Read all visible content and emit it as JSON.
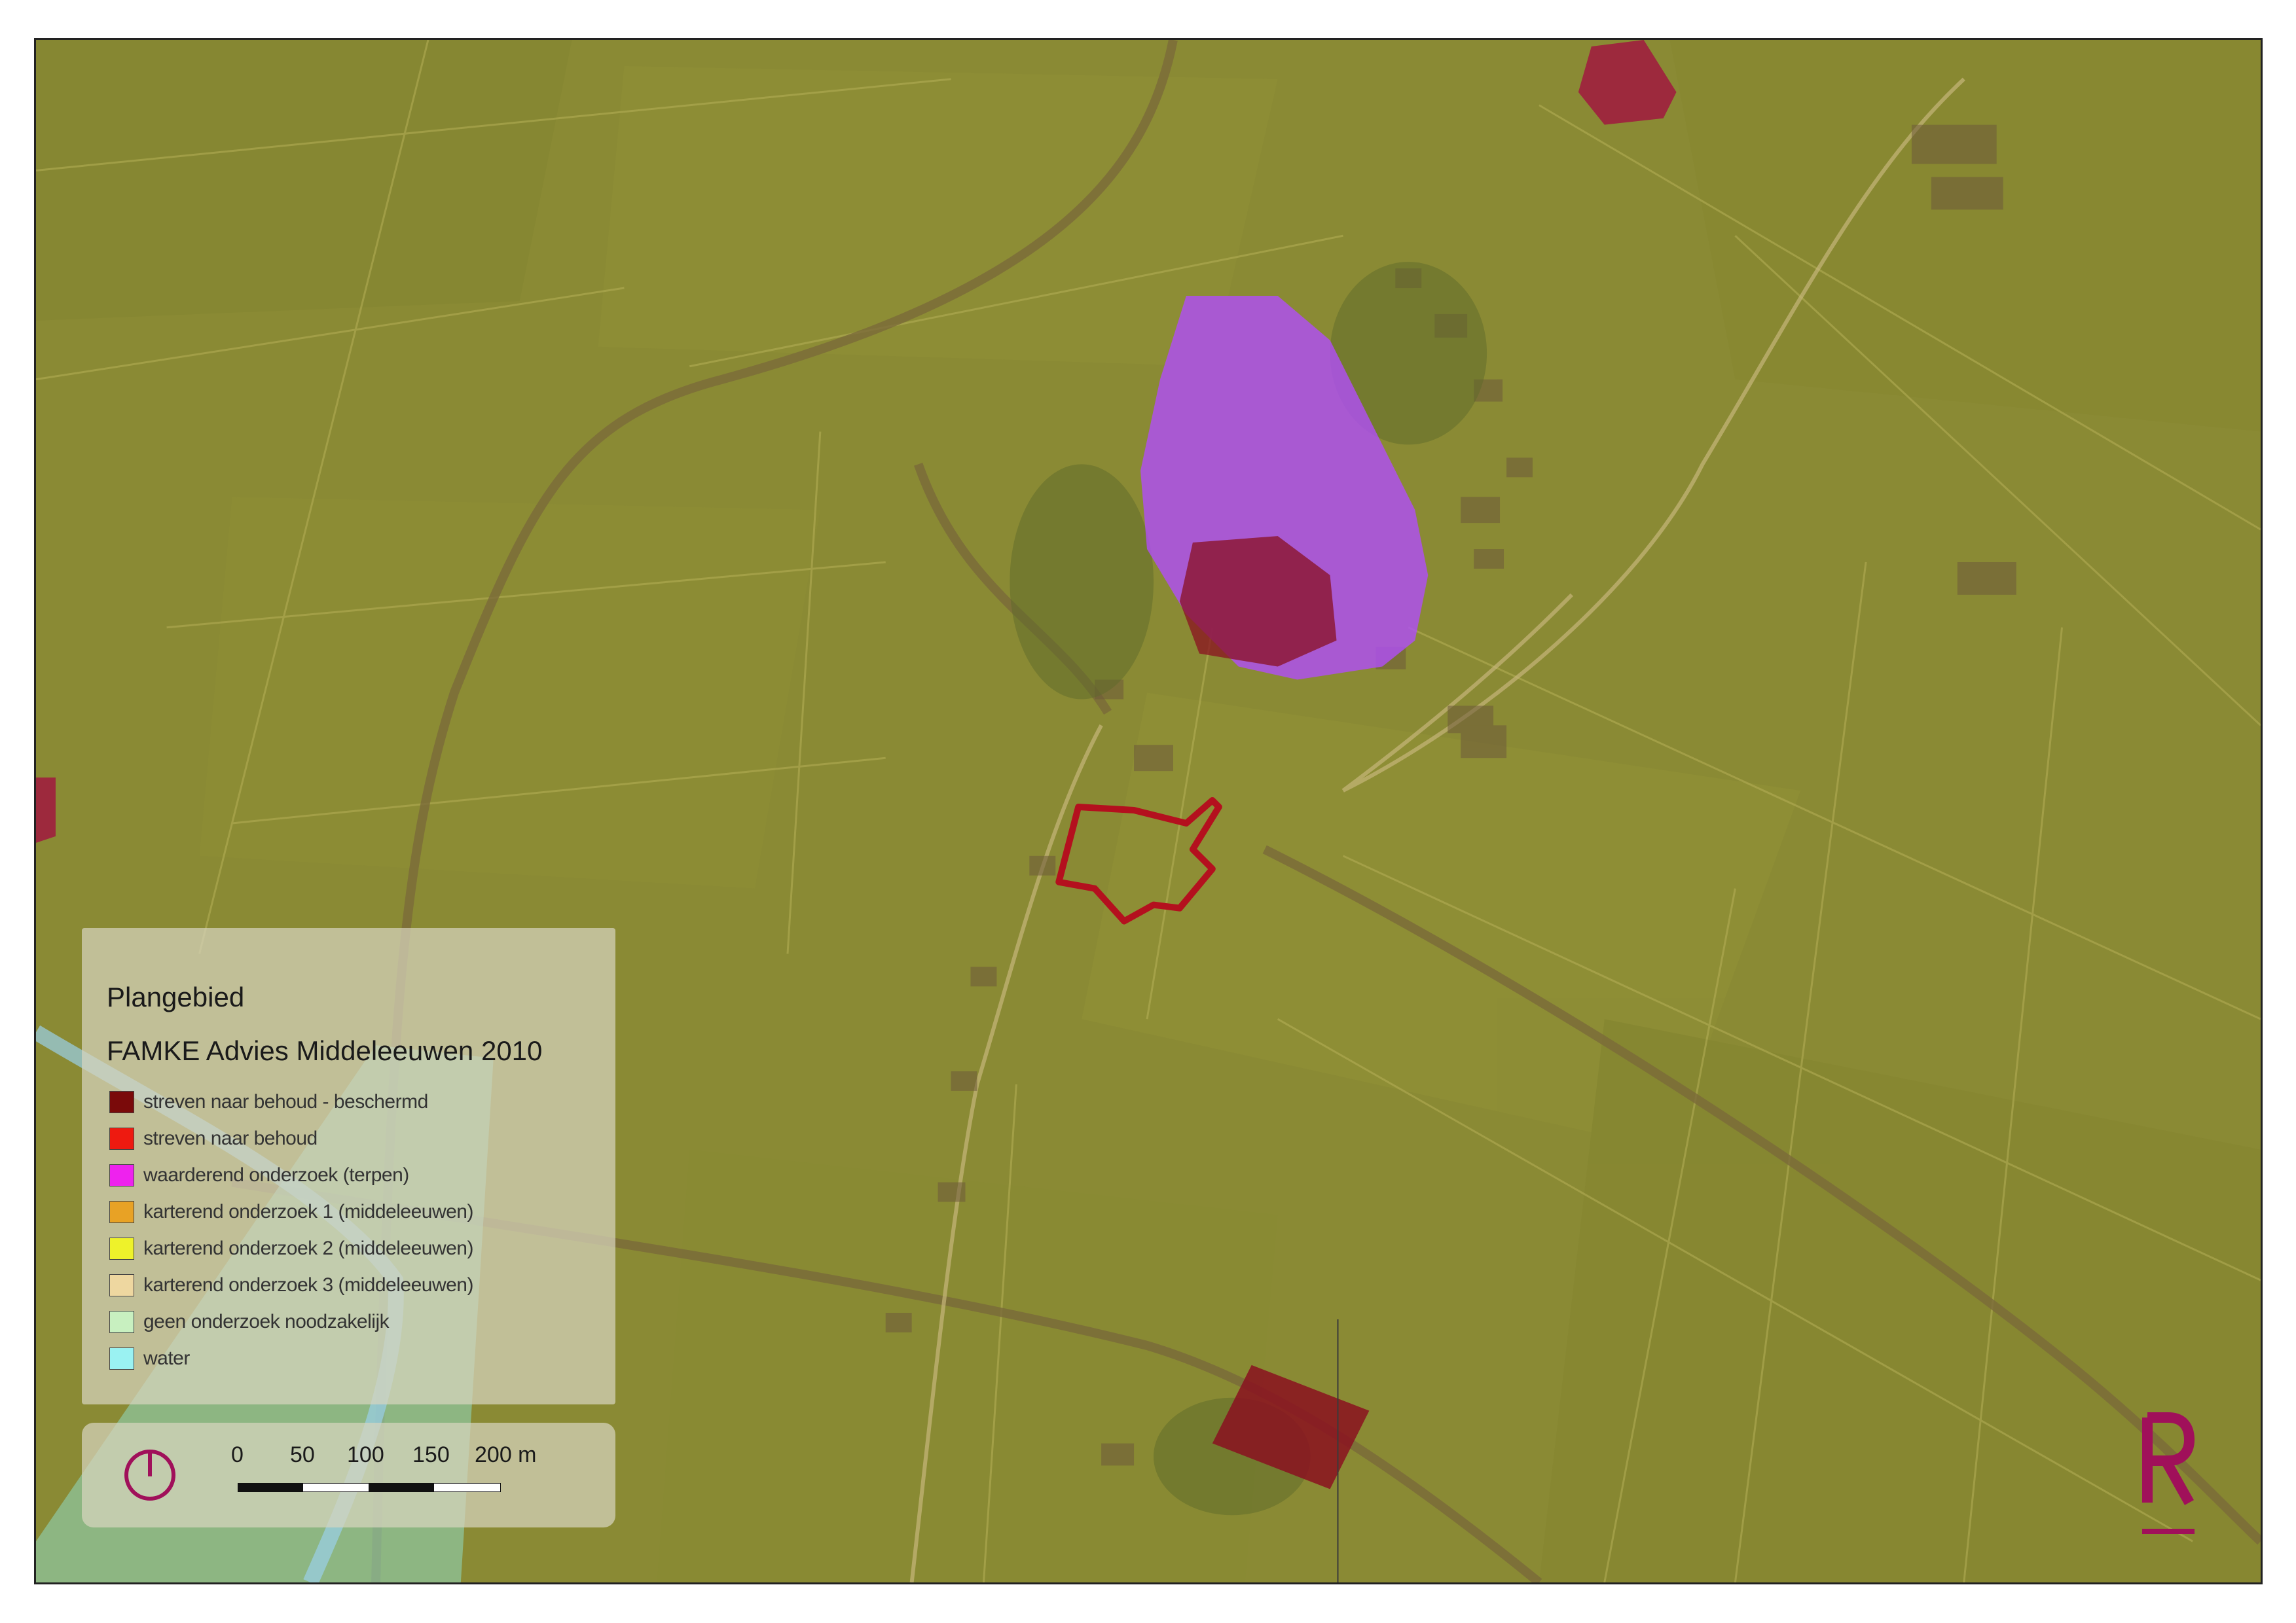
{
  "legend": {
    "plan_title": "Plangebied",
    "section_title": "FAMKE Advies Middeleeuwen 2010",
    "items": [
      {
        "label": "streven naar behoud - beschermd",
        "color": "#7a0a0a"
      },
      {
        "label": "streven naar behoud",
        "color": "#ee1a10"
      },
      {
        "label": "waarderend onderzoek (terpen)",
        "color": "#ee22ee"
      },
      {
        "label": "karterend onderzoek 1 (middeleeuwen)",
        "color": "#e8a225"
      },
      {
        "label": "karterend onderzoek 2 (middeleeuwen)",
        "color": "#eef22a"
      },
      {
        "label": "karterend onderzoek 3 (middeleeuwen)",
        "color": "#eed7a0"
      },
      {
        "label": "geen onderzoek noodzakelijk",
        "color": "#c8f0c0"
      },
      {
        "label": "water",
        "color": "#9af2f2"
      }
    ]
  },
  "scale": {
    "ticks": [
      "0",
      "50",
      "100",
      "150",
      "200 m"
    ]
  },
  "icons": {
    "north": "power-style-north-icon",
    "logo": "r-logo-icon"
  },
  "colors": {
    "accent": "#a0105a",
    "plan_outline": "#b4101e",
    "field": "#8a8a34"
  }
}
